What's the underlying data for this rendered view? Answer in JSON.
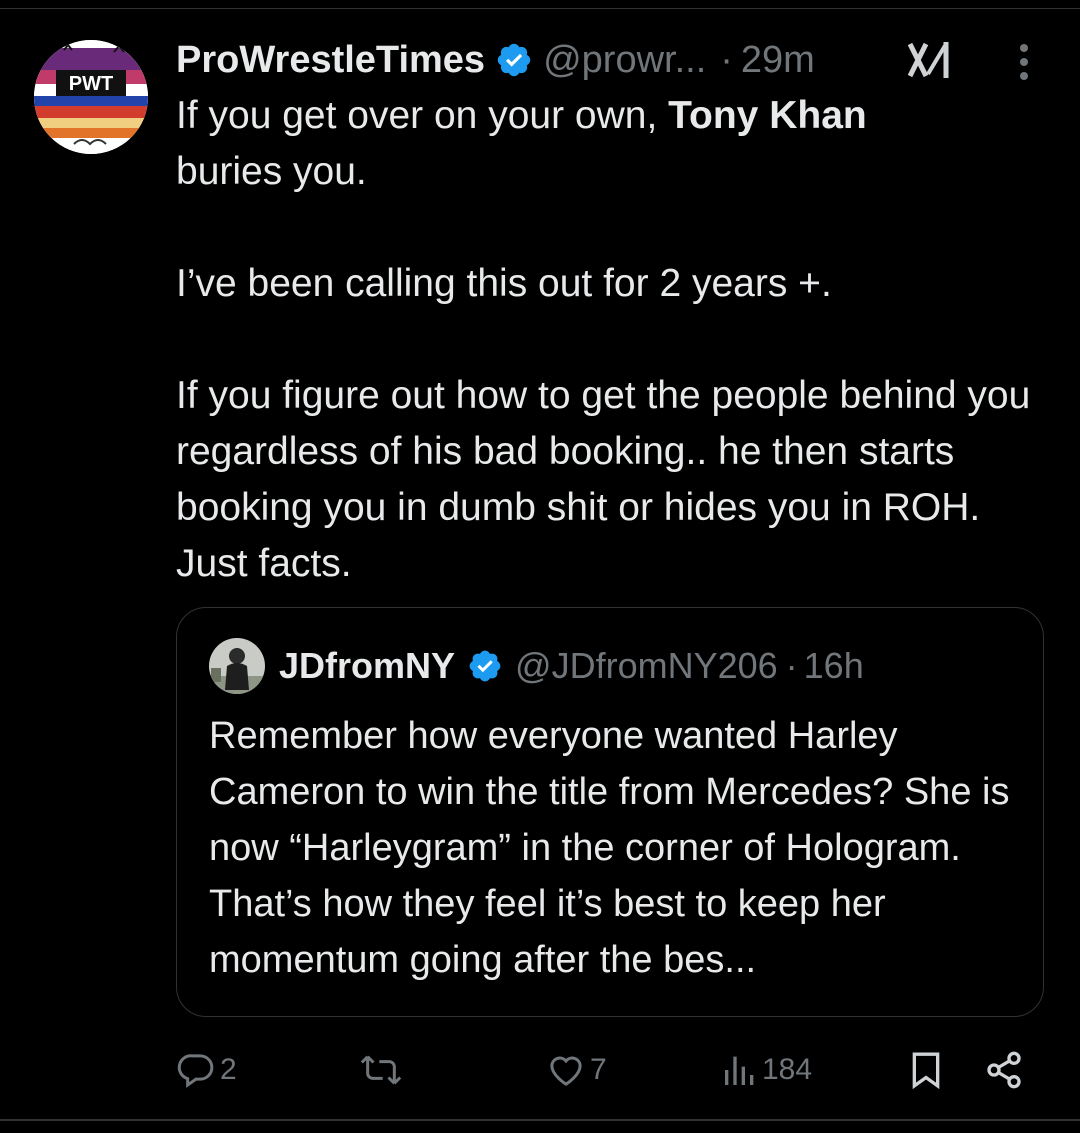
{
  "tweet": {
    "display_name": "ProWrestleTimes",
    "handle": "@prowr...",
    "separator": "·",
    "time": "29m",
    "avatar_text": "PWT",
    "text_part1": "If you get over on your own, ",
    "text_bold": "Tony Khan",
    "text_part2": " buries you.",
    "paragraph2": "I’ve been calling this out for 2 years +.",
    "paragraph3": "If you figure out how to get the people behind you regardless of his bad booking.. he then starts booking you in dumb shit or hides you in ROH. Just facts."
  },
  "quote": {
    "display_name": "JDfromNY",
    "handle": "@JDfromNY206",
    "separator": "·",
    "time": "16h",
    "text": "Remember how everyone wanted Harley Cameron to win the title from Mercedes? She is now “Harleygram” in the corner of Hologram. That’s how they feel it’s best to keep her momentum going after the bes..."
  },
  "actions": {
    "replies": "2",
    "retweets": "",
    "likes": "7",
    "views": "184"
  },
  "icons": {
    "verified": "verified-badge-icon",
    "grok": "grok-icon",
    "more": "more-options-icon",
    "reply": "reply-icon",
    "retweet": "retweet-icon",
    "like": "heart-icon",
    "views": "views-chart-icon",
    "bookmark": "bookmark-icon",
    "share": "share-icon"
  },
  "colors": {
    "background": "#000000",
    "text": "#e7e9ea",
    "secondary_text": "#71767b",
    "verified_blue": "#1d9bf0",
    "border": "#2f3336"
  }
}
